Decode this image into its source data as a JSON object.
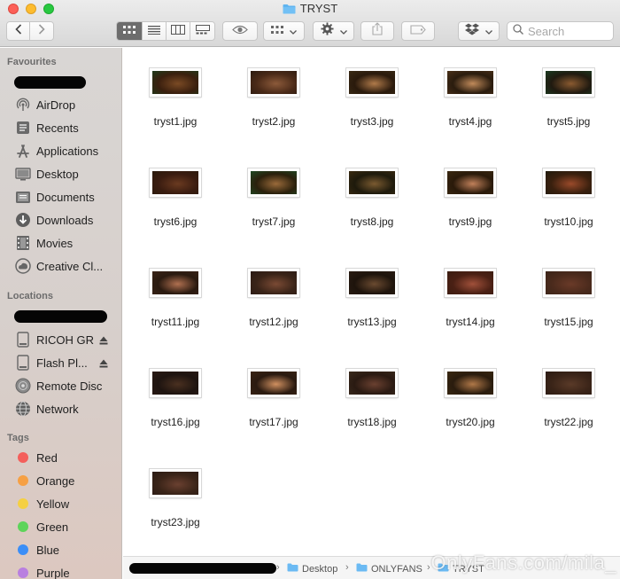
{
  "window": {
    "title": "TRYST"
  },
  "toolbar": {
    "search_placeholder": "Search",
    "icons": [
      "back-chevron-icon",
      "forward-chevron-icon",
      "icon-view-icon",
      "list-view-icon",
      "column-view-icon",
      "gallery-view-icon",
      "quicklook-eye-icon",
      "group-grid-icon",
      "gear-icon",
      "share-icon",
      "tag-icon",
      "dropbox-icon",
      "search-icon"
    ]
  },
  "sidebar": {
    "favourites_header": "Favourites",
    "favourites": [
      {
        "label": "AirDrop",
        "icon": "airdrop-icon"
      },
      {
        "label": "Recents",
        "icon": "recents-icon"
      },
      {
        "label": "Applications",
        "icon": "applications-icon"
      },
      {
        "label": "Desktop",
        "icon": "desktop-icon"
      },
      {
        "label": "Documents",
        "icon": "documents-icon"
      },
      {
        "label": "Downloads",
        "icon": "downloads-icon"
      },
      {
        "label": "Movies",
        "icon": "movies-icon"
      },
      {
        "label": "Creative Cl...",
        "icon": "creative-cloud-icon"
      }
    ],
    "locations_header": "Locations",
    "locations": [
      {
        "label": "RICOH GR",
        "icon": "drive-icon"
      },
      {
        "label": "Flash Pl...",
        "icon": "drive-icon"
      },
      {
        "label": "Remote Disc",
        "icon": "remote-disc-icon"
      },
      {
        "label": "Network",
        "icon": "network-icon"
      }
    ],
    "tags_header": "Tags",
    "tags": [
      {
        "label": "Red",
        "color": "#f45f5b"
      },
      {
        "label": "Orange",
        "color": "#f6a044"
      },
      {
        "label": "Yellow",
        "color": "#f5d043"
      },
      {
        "label": "Green",
        "color": "#5ed45a"
      },
      {
        "label": "Blue",
        "color": "#3b8ef7"
      },
      {
        "label": "Purple",
        "color": "#b97fe0"
      }
    ]
  },
  "files": [
    "tryst1.jpg",
    "tryst2.jpg",
    "tryst3.jpg",
    "tryst4.jpg",
    "tryst5.jpg",
    "tryst6.jpg",
    "tryst7.jpg",
    "tryst8.jpg",
    "tryst9.jpg",
    "tryst10.jpg",
    "tryst11.jpg",
    "tryst12.jpg",
    "tryst13.jpg",
    "tryst14.jpg",
    "tryst15.jpg",
    "tryst16.jpg",
    "tryst17.jpg",
    "tryst18.jpg",
    "tryst20.jpg",
    "tryst22.jpg",
    "tryst23.jpg"
  ],
  "pathbar": {
    "crumbs": [
      "Desktop",
      "ONLYFANS",
      "TRYST"
    ]
  },
  "watermark": "OnlyFans.com/mila_"
}
